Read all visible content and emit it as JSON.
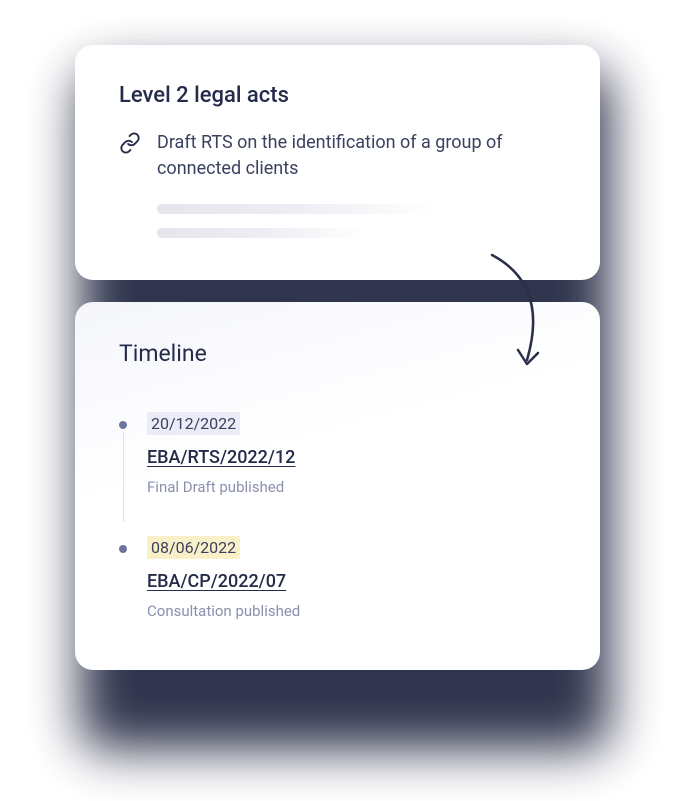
{
  "topCard": {
    "title": "Level 2 legal acts",
    "linkText": "Draft RTS on the identification of a group of connected clients"
  },
  "bottomCard": {
    "title": "Timeline"
  },
  "timeline": [
    {
      "date": "20/12/2022",
      "ref": "EBA/RTS/2022/12",
      "status": "Final Draft published",
      "badgeClass": "lavender"
    },
    {
      "date": "08/06/2022",
      "ref": "EBA/CP/2022/07",
      "status": "Consultation published",
      "badgeClass": "yellow"
    }
  ]
}
